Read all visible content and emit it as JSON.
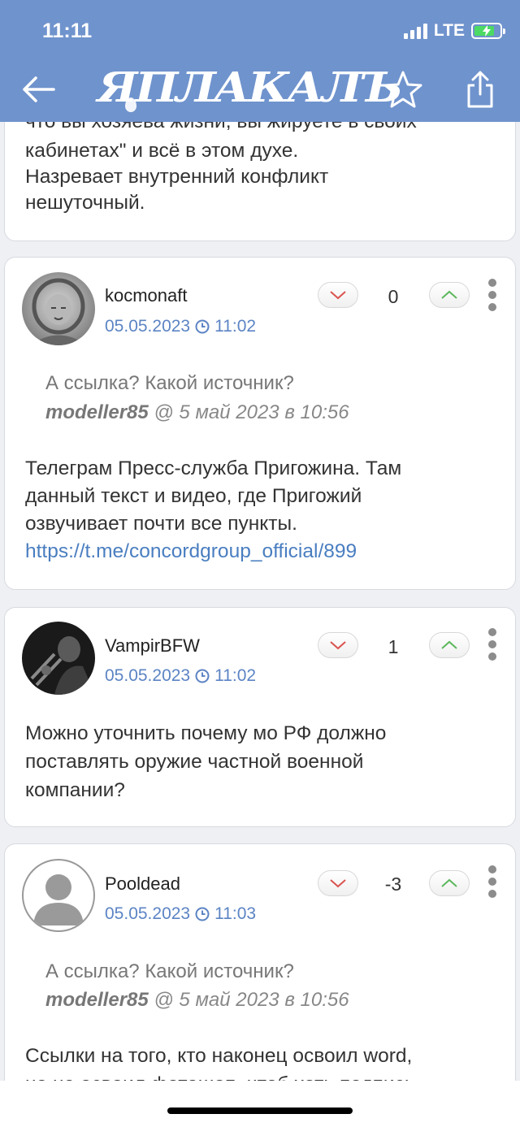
{
  "status_bar": {
    "time": "11:11",
    "network": "LTE"
  },
  "header": {
    "logo": "ЯПЛАКАЛЪ",
    "back_icon": "back-arrow-icon",
    "favorite_icon": "star-icon",
    "share_icon": "share-icon"
  },
  "first_card": {
    "partial_line": "что вы хозяева жизни, вы жируете в своих",
    "lines": [
      "кабинетах\" и всё в этом духе.",
      "Назревает внутренний конфликт",
      "нешуточный."
    ]
  },
  "posts": [
    {
      "username": "kocmonaft",
      "date": "05.05.2023",
      "time": "11:02",
      "score": "0",
      "quote": {
        "text": "А ссылка? Какой источник?",
        "author": "modeller85",
        "meta": " @ 5 май 2023 в 10:56"
      },
      "body_lines": [
        "Телеграм Пресс-служба Пригожина. Там",
        "данный текст и видео, где Пригожий",
        "озвучивает почти все пункты."
      ],
      "link": "https://t.me/concordgroup_official/899"
    },
    {
      "username": "VampirBFW",
      "date": "05.05.2023",
      "time": "11:02",
      "score": "1",
      "body_lines": [
        "Можно уточнить почему мо РФ должно",
        "поставлять оружие частной военной",
        "компании?"
      ]
    },
    {
      "username": "Pooldead",
      "date": "05.05.2023",
      "time": "11:03",
      "score": "-3",
      "quote": {
        "text": "А ссылка? Какой источник?",
        "author": "modeller85",
        "meta": " @ 5 май 2023 в 10:56"
      },
      "body_lines": [
        "Ссылки на того, кто наконец освоил word,",
        "но не освоил фотошоп, чтоб хоть подпись"
      ]
    }
  ],
  "colors": {
    "header": "#6f93cd",
    "date": "#5c84c4",
    "link": "#4a7ec0",
    "vote_down": "#d9534f",
    "vote_up": "#5cb85c"
  }
}
